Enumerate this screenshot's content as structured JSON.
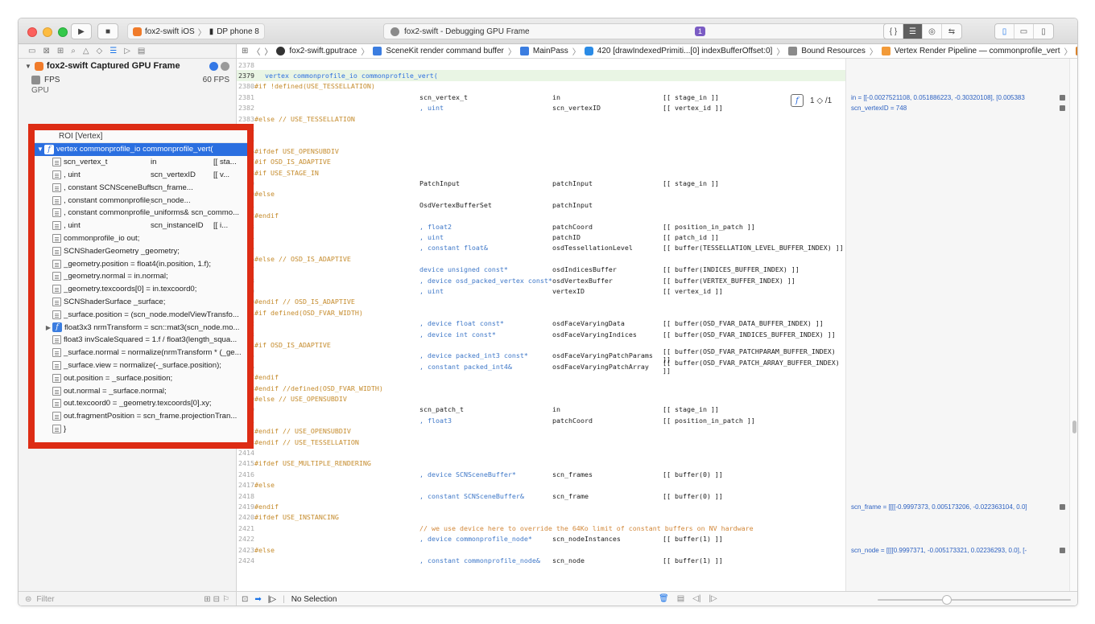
{
  "titlebar": {
    "scheme": "fox2-swift iOS",
    "device": "DP phone 8",
    "activity_title": "fox2-swift - Debugging GPU Frame",
    "issue_count": "1"
  },
  "navigator": {
    "root_label": "fox2-swift Captured GPU Frame",
    "fps_label": "FPS",
    "fps_value": "60 FPS",
    "gpu_label": "GPU",
    "roi_header": "ROI [Vertex]",
    "selected_function": "vertex commonprofile_io commonprofile_vert(",
    "rows": [
      {
        "a": "scn_vertex_t",
        "b": "in",
        "c": "[[ sta..."
      },
      {
        "a": ", uint",
        "b": "scn_vertexID",
        "c": "[[ v..."
      },
      {
        "a": ", constant SCNSceneBuffer&",
        "b": "scn_frame...",
        "c": ""
      },
      {
        "a": ", constant commonprofile_node&",
        "b": "scn_node...",
        "c": ""
      },
      {
        "a": ", constant commonprofile_uniforms& scn_commo...",
        "b": "",
        "c": ""
      },
      {
        "a": ", uint",
        "b": "scn_instanceID",
        "c": "[[ i..."
      },
      {
        "a": "commonprofile_io out;",
        "b": "",
        "c": ""
      },
      {
        "a": "SCNShaderGeometry _geometry;",
        "b": "",
        "c": ""
      },
      {
        "a": "_geometry.position = float4(in.position, 1.f);",
        "b": "",
        "c": ""
      },
      {
        "a": "_geometry.normal = in.normal;",
        "b": "",
        "c": ""
      },
      {
        "a": "_geometry.texcoords[0] = in.texcoord0;",
        "b": "",
        "c": ""
      },
      {
        "a": "SCNShaderSurface _surface;",
        "b": "",
        "c": ""
      },
      {
        "a": "_surface.position = (scn_node.modelViewTransfo...",
        "b": "",
        "c": ""
      }
    ],
    "fn_row": "float3x3 nrmTransform = scn::mat3(scn_node.mo...",
    "rows_after": [
      "float3 invScaleSquared = 1.f / float3(length_squa...",
      "_surface.normal = normalize(nrmTransform * (_ge...",
      "_surface.view = normalize(-_surface.position);",
      "out.position = _surface.position;",
      "out.normal = _surface.normal;",
      "out.texcoord0 = _geometry.texcoords[0].xy;",
      "out.fragmentPosition = scn_frame.projectionTran...",
      "}"
    ],
    "filter_placeholder": "Filter"
  },
  "jumpbar": {
    "items": [
      "fox2-swift.gputrace",
      "SceneKit render command buffer",
      "MainPass",
      "420 [drawIndexedPrimiti...[0] indexBufferOffset:0]",
      "Bound Resources",
      "Vertex Render Pipeline — commonprofile_vert",
      "commonprofile_vert"
    ]
  },
  "find": {
    "counter": "1",
    "total": "/1"
  },
  "code": [
    {
      "n": "2378",
      "pp": "",
      "a": "",
      "b": "",
      "c": "",
      "d": ""
    },
    {
      "n": "2379",
      "fn": "vertex commonprofile_io commonprofile_vert(",
      "hl": true
    },
    {
      "n": "2380",
      "pp": "#if !defined(USE_TESSELLATION)"
    },
    {
      "n": "2381",
      "a": "scn_vertex_t",
      "b": "in",
      "c": "[[ stage_in ]]"
    },
    {
      "n": "2382",
      "a": ", uint",
      "akw": true,
      "b": "scn_vertexID",
      "c": "[[ vertex_id ]]"
    },
    {
      "n": "2383",
      "pp": "#else // USE_TESSELLATION"
    },
    {
      "n": "2384"
    },
    {
      "n": "2385"
    },
    {
      "n": "2386",
      "pp": "#ifdef USE_OPENSUBDIV"
    },
    {
      "n": "2387",
      "pp": "#if OSD_IS_ADAPTIVE"
    },
    {
      "n": "2388",
      "pp": "#if USE_STAGE_IN"
    },
    {
      "n": "2389",
      "a": "PatchInput",
      "b": "patchInput",
      "c": "[[ stage_in ]]"
    },
    {
      "n": "2390",
      "pp": "#else"
    },
    {
      "n": "2391",
      "a": "OsdVertexBufferSet",
      "b": "patchInput"
    },
    {
      "n": "2392",
      "pp": "#endif"
    },
    {
      "n": "2393",
      "a": ", float2",
      "akw": true,
      "b": "patchCoord",
      "c": "[[ position_in_patch ]]"
    },
    {
      "n": "2394",
      "a": ", uint",
      "akw": true,
      "b": "patchID",
      "c": "[[ patch_id ]]"
    },
    {
      "n": "2395",
      "a": ", constant float&",
      "akw": true,
      "b": "osdTessellationLevel",
      "c": "[[ buffer(TESSELLATION_LEVEL_BUFFER_INDEX) ]]"
    },
    {
      "n": "2396",
      "pp": "#else // OSD_IS_ADAPTIVE"
    },
    {
      "n": "2397",
      "a": "device unsigned const*",
      "akw": true,
      "b": "osdIndicesBuffer",
      "c": "[[ buffer(INDICES_BUFFER_INDEX) ]]"
    },
    {
      "n": "2398",
      "a": ", device osd_packed_vertex const*",
      "akw": true,
      "b": "osdVertexBuffer",
      "c": "[[ buffer(VERTEX_BUFFER_INDEX) ]]"
    },
    {
      "n": "2399",
      "a": ", uint",
      "akw": true,
      "b": "vertexID",
      "c": "[[ vertex_id ]]"
    },
    {
      "n": "2400",
      "pp": "#endif // OSD_IS_ADAPTIVE"
    },
    {
      "n": "2401",
      "pp": "#if defined(OSD_FVAR_WIDTH)"
    },
    {
      "n": "2402",
      "a": ", device float const*",
      "akw": true,
      "b": "osdFaceVaryingData",
      "c": "[[ buffer(OSD_FVAR_DATA_BUFFER_INDEX) ]]"
    },
    {
      "n": "2403",
      "a": ", device int const*",
      "akw": true,
      "b": "osdFaceVaryingIndices",
      "c": "[[ buffer(OSD_FVAR_INDICES_BUFFER_INDEX) ]]"
    },
    {
      "n": "2404",
      "pp": "#if OSD_IS_ADAPTIVE"
    },
    {
      "n": "2405",
      "a": ", device packed_int3 const*",
      "akw": true,
      "b": "osdFaceVaryingPatchParams",
      "c": "[[ buffer(OSD_FVAR_PATCHPARAM_BUFFER_INDEX) ]]"
    },
    {
      "n": "2406",
      "a": ", constant packed_int4&",
      "akw": true,
      "b": "osdFaceVaryingPatchArray",
      "c": "[[ buffer(OSD_FVAR_PATCH_ARRAY_BUFFER_INDEX) ]]"
    },
    {
      "n": "2407",
      "pp": "#endif"
    },
    {
      "n": "2408",
      "pp": "#endif //defined(OSD_FVAR_WIDTH)"
    },
    {
      "n": "2409",
      "pp": "#else // USE_OPENSUBDIV"
    },
    {
      "n": "2410",
      "a": "scn_patch_t",
      "b": "in",
      "c": "[[ stage_in ]]"
    },
    {
      "n": "2411",
      "a": ", float3",
      "akw": true,
      "b": "patchCoord",
      "c": "[[ position_in_patch ]]"
    },
    {
      "n": "2412",
      "pp": "#endif // USE_OPENSUBDIV"
    },
    {
      "n": "2413",
      "pp": "#endif // USE_TESSELLATION"
    },
    {
      "n": "2414"
    },
    {
      "n": "2415",
      "pp": "#ifdef USE_MULTIPLE_RENDERING"
    },
    {
      "n": "2416",
      "a": ", device SCNSceneBuffer*",
      "akw": true,
      "b": "scn_frames",
      "c": "[[ buffer(0) ]]"
    },
    {
      "n": "2417",
      "pp": "#else"
    },
    {
      "n": "2418",
      "a": ", constant SCNSceneBuffer&",
      "akw": true,
      "b": "scn_frame",
      "c": "[[ buffer(0) ]]"
    },
    {
      "n": "2419",
      "pp": "#endif"
    },
    {
      "n": "2420",
      "pp": "#ifdef USE_INSTANCING"
    },
    {
      "n": "2421",
      "cm": "// we use device here to override the 64Ko limit of constant buffers on NV hardware"
    },
    {
      "n": "2422",
      "a": ", device commonprofile_node*",
      "akw": true,
      "b": "scn_nodeInstances",
      "c": "[[ buffer(1) ]]"
    },
    {
      "n": "2423",
      "pp": "#else"
    },
    {
      "n": "2424",
      "a": ", constant commonprofile_node&",
      "akw": true,
      "b": "scn_node",
      "c": "[[ buffer(1) ]]"
    }
  ],
  "values": [
    {
      "line": 3,
      "text": "in = [[-0.0027521108, 0.051886223, -0.30320108], [0.005383"
    },
    {
      "line": 4,
      "text": "scn_vertexID = 748"
    },
    {
      "line": 41,
      "text": "scn_frame = [[[[-0.9997373, 0.005173206, -0.022363104, 0.0]"
    },
    {
      "line": 45,
      "text": "scn_node = [[[[0.9997371, -0.005173321, 0.02236293, 0.0], [-"
    }
  ],
  "debugbar": {
    "status": "No Selection"
  }
}
